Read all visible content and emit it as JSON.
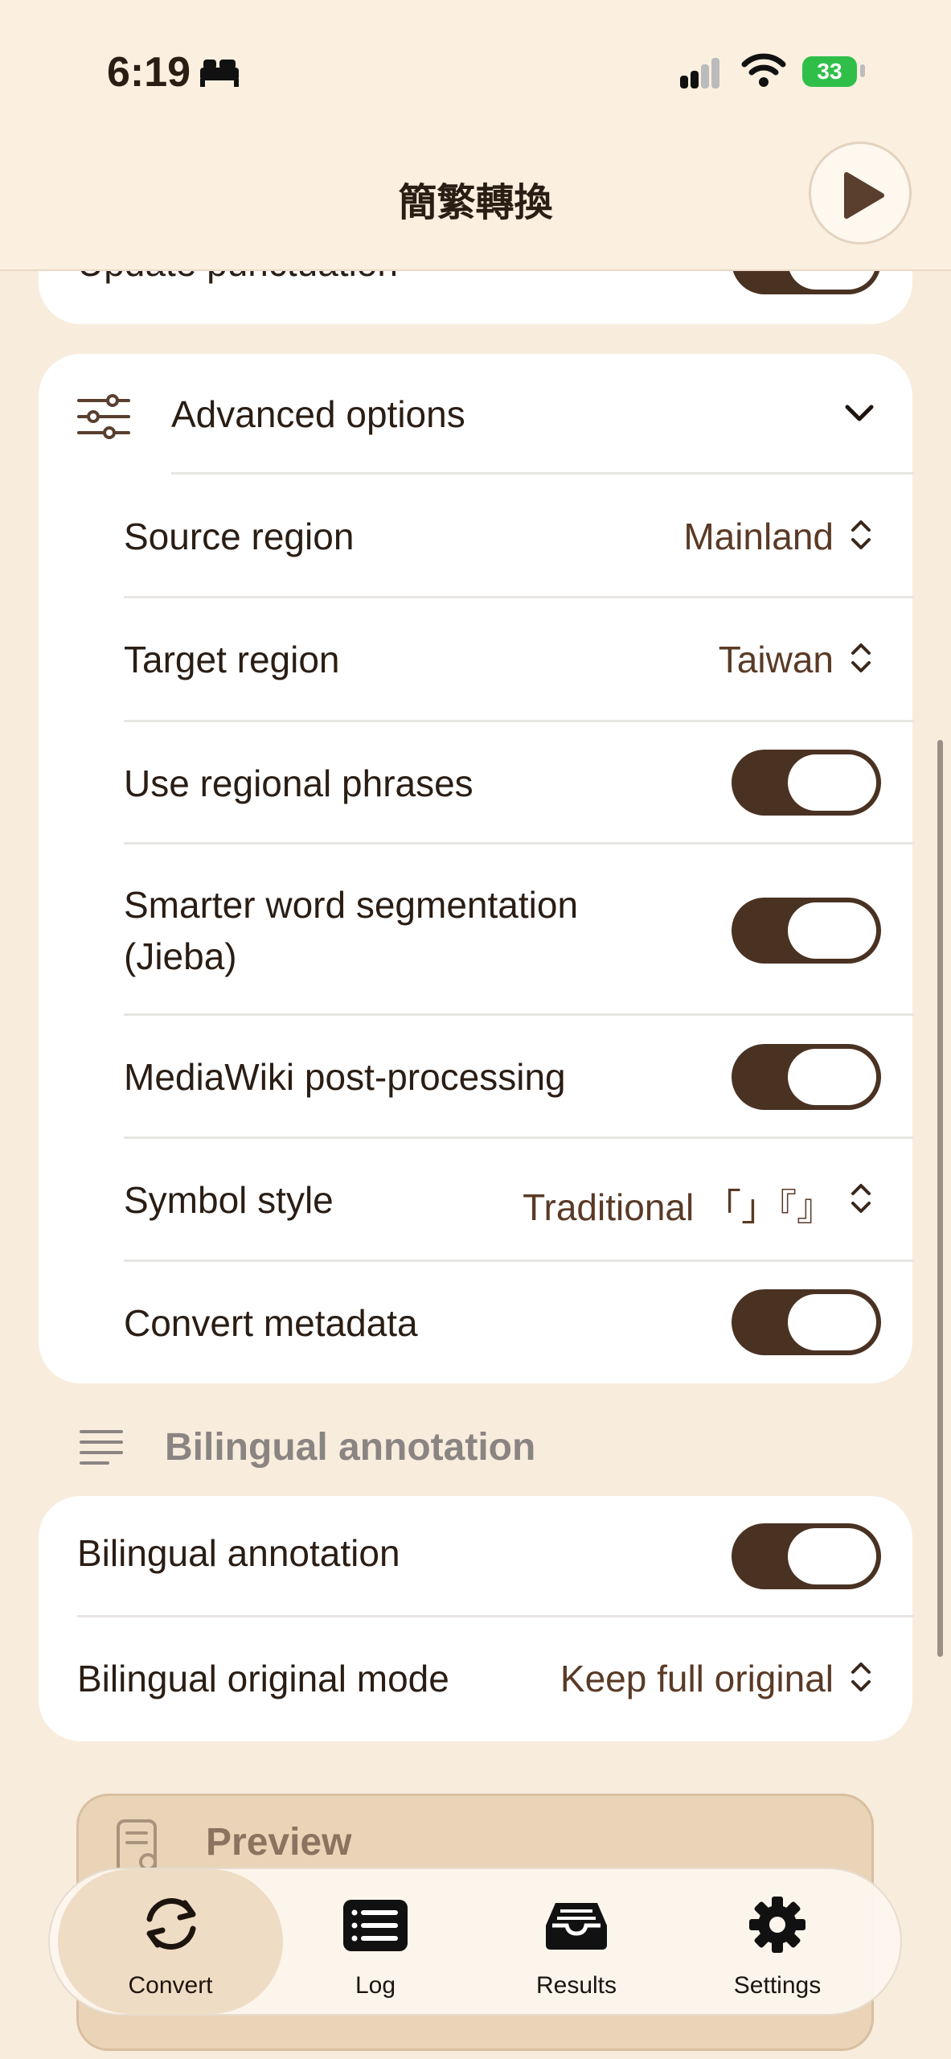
{
  "status_bar": {
    "time": "6:19",
    "battery": "33"
  },
  "header": {
    "title": "簡繁轉換"
  },
  "top_card": {
    "label": "Update punctuation",
    "toggle_on": true
  },
  "advanced": {
    "title": "Advanced options",
    "rows": [
      {
        "label": "Source region",
        "value": "Mainland"
      },
      {
        "label": "Target region",
        "value": "Taiwan"
      },
      {
        "label": "Use regional phrases",
        "toggle_on": true
      },
      {
        "label_line1": "Smarter word segmentation",
        "label_line2": "(Jieba)",
        "toggle_on": true
      },
      {
        "label": "MediaWiki post-processing",
        "toggle_on": true
      },
      {
        "label": "Symbol style",
        "value": "Traditional 「」『』"
      },
      {
        "label": "Convert metadata",
        "toggle_on": true
      }
    ]
  },
  "bilingual": {
    "section_title": "Bilingual annotation",
    "rows": [
      {
        "label": "Bilingual annotation",
        "toggle_on": true
      },
      {
        "label": "Bilingual original mode",
        "value": "Keep full original"
      }
    ]
  },
  "preview": {
    "label": "Preview"
  },
  "tabs": [
    {
      "label": "Convert",
      "icon": "refresh-icon",
      "active": true
    },
    {
      "label": "Log",
      "icon": "list-icon"
    },
    {
      "label": "Results",
      "icon": "tray-icon"
    },
    {
      "label": "Settings",
      "icon": "gear-icon"
    }
  ],
  "colors": {
    "background": "#f8ecdd",
    "toggle_on": "#4a3223",
    "accent_text": "#5a3a26"
  }
}
